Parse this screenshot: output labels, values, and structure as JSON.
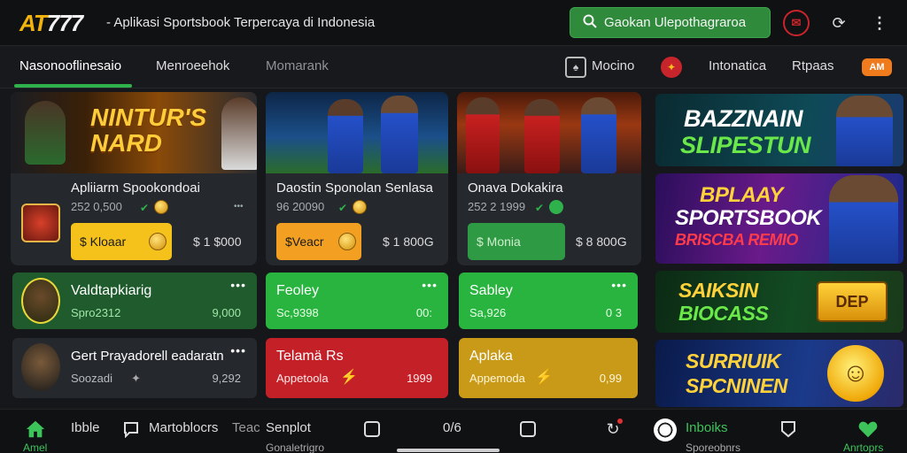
{
  "header": {
    "logo_a": "AT",
    "logo_b": "777",
    "tagline": "- Aplikasi Sportsbook Terpercaya di Indonesia",
    "cta_label": "Gaokan Ulepothagraroa"
  },
  "nav": {
    "items": [
      "Nasonooflinesaio",
      "Menroeehok",
      "Momarank"
    ],
    "right_items": [
      "Mocino",
      "Intonatica",
      "Rtpaas"
    ],
    "pill": "AM"
  },
  "featured": [
    {
      "banner": "NINTUR'S NARD",
      "title": "Apliiarm Spookondoai",
      "sub": "252 0,500",
      "bet_label": "$ Kloaar",
      "bet_value": "$ 1 $000",
      "accent": "#f5c21b"
    },
    {
      "banner": "",
      "title": "Daostin Sponolan Senlasa",
      "sub": "96 20090",
      "bet_label": "$Veacr",
      "bet_value": "$ 1 800G",
      "accent": "#f3a022"
    },
    {
      "banner": "",
      "title": "Onava Dokakira",
      "sub": "252 2 1999",
      "bet_label": "$ Monia",
      "bet_value": "$ 8 800G",
      "accent": "#2e9a44"
    }
  ],
  "tiles": [
    {
      "title": "Valdtapkiarig",
      "sub": "Spro2312",
      "value": "9,000"
    },
    {
      "title": "Feoley",
      "sub": "Sc,9398",
      "value": "00:"
    },
    {
      "title": "Sabley",
      "sub": "Sa,926",
      "value": "0 3"
    },
    {
      "title": "Gert Prayadorell eadaratn",
      "sub": "Soozadi",
      "value": "9,292"
    },
    {
      "title": "Telamä Rs",
      "sub": "Appetoola",
      "value": "1999"
    },
    {
      "title": "Aplaka",
      "sub": "Appemoda",
      "value": "0,99"
    }
  ],
  "banners": [
    {
      "line1": "BAZZNAIN",
      "line2": "SLIPESTUN"
    },
    {
      "line1": "BPLAAY",
      "line2": "SPORTSBOOK",
      "line3": "BRISCBA REMIO"
    },
    {
      "line1": "SAIKSIN",
      "line2": "BIOCASS",
      "badge": "DEP"
    },
    {
      "line1": "SURRIUIK",
      "line2": "SPCNINEN"
    }
  ],
  "bottom": {
    "items": [
      "Amel",
      "Ibble",
      "Martoblocrs",
      "Teac",
      "Senplot",
      "0/6"
    ],
    "sub_items": [
      "Gonaletrigro"
    ],
    "right_label": "Inboiks",
    "right_sub": "Sporeobnrs",
    "right_end": "Anrtoprs"
  }
}
